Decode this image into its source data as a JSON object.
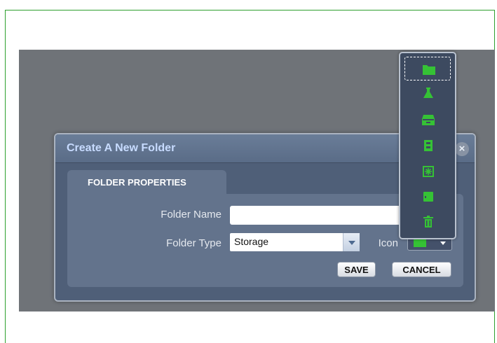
{
  "dialog": {
    "title": "Create A New Folder",
    "close_label": "×",
    "tab_label": "FOLDER PROPERTIES",
    "folder_name": {
      "label": "Folder Name",
      "value": ""
    },
    "folder_type": {
      "label": "Folder Type",
      "value": "Storage"
    },
    "icon": {
      "label": "Icon",
      "selected": "folder-icon"
    },
    "save_label": "SAVE",
    "cancel_label": "CANCEL"
  },
  "icon_dropdown": {
    "items": [
      {
        "icon": "folder-icon",
        "selected": true
      },
      {
        "icon": "flask-icon",
        "selected": false
      },
      {
        "icon": "drawer-icon",
        "selected": false
      },
      {
        "icon": "cabinet-icon",
        "selected": false
      },
      {
        "icon": "asterisk-box-icon",
        "selected": false
      },
      {
        "icon": "box-icon",
        "selected": false
      },
      {
        "icon": "trash-icon",
        "selected": false
      }
    ]
  },
  "colors": {
    "accent_green": "#35c235",
    "dialog_bg": "#4f5f78",
    "title_color": "#c7dbff",
    "frame_border": "#2ea02e"
  }
}
